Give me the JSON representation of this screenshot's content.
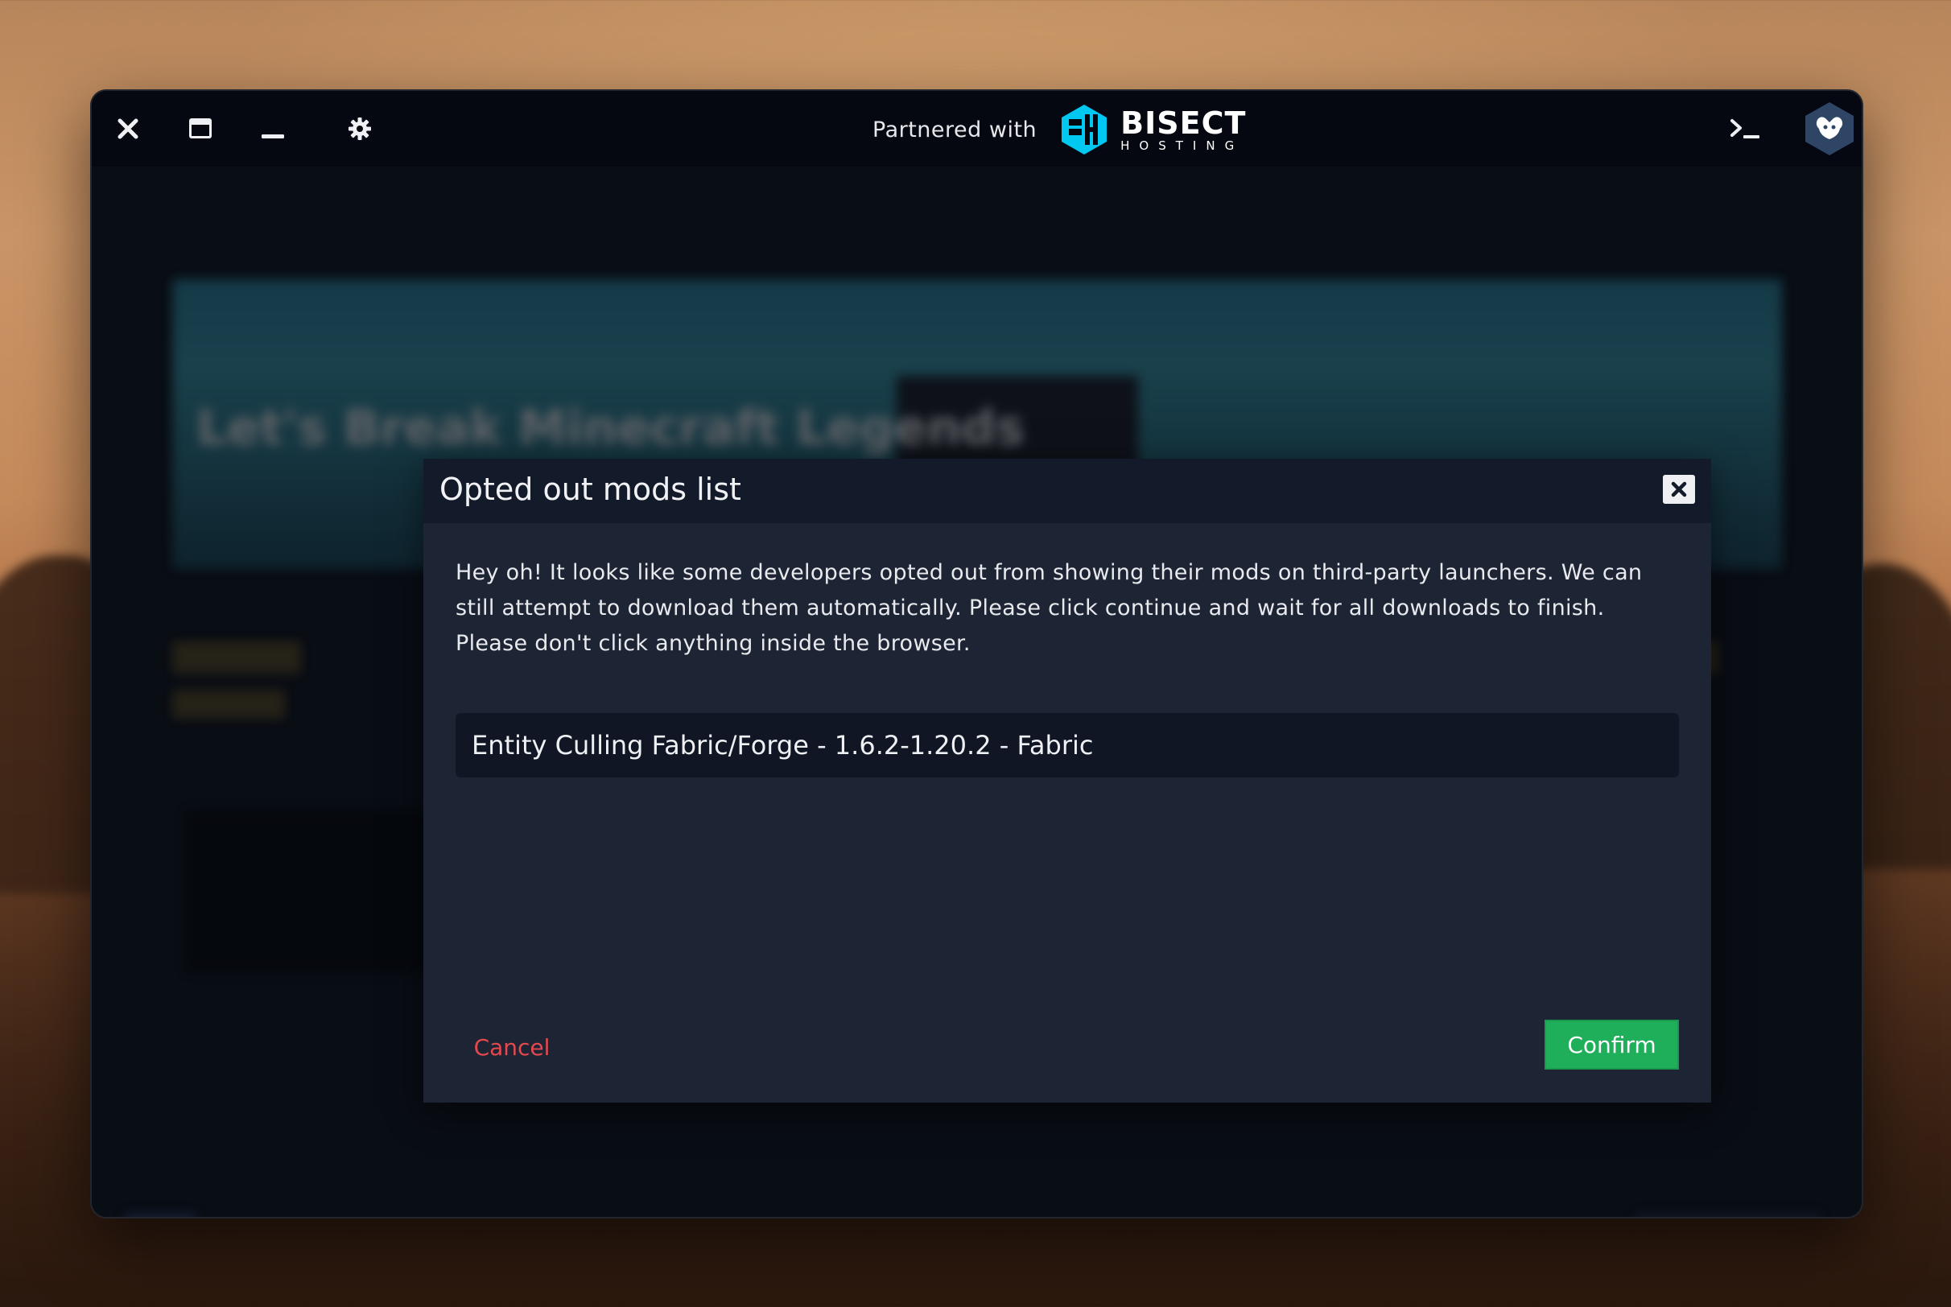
{
  "titlebar": {
    "partner_text": "Partnered with",
    "partner_brand": "BISECT",
    "partner_brand_sub": "HOSTING",
    "icons": [
      "close-icon",
      "maximize-icon",
      "minimize-icon",
      "gear-icon",
      "terminal-icon",
      "avatar-icon"
    ]
  },
  "background": {
    "banner_title": "Let's Break Minecraft Legends"
  },
  "modal": {
    "title": "Opted out mods list",
    "description": "Hey oh! It looks like some developers opted out from showing their mods on third-party launchers. We can still attempt to download them automatically. Please click continue and wait for all downloads to finish. Please don't click anything inside the browser.",
    "mods": [
      "Entity Culling Fabric/Forge - 1.6.2-1.20.2 - Fabric"
    ],
    "cancel_label": "Cancel",
    "confirm_label": "Confirm"
  },
  "colors": {
    "window_bg": "#090d14",
    "modal_bg": "#1d2535",
    "modal_header_bg": "#131a29",
    "confirm": "#1fae5a",
    "cancel_text": "#e5484d",
    "brand_accent": "#00c8f0"
  }
}
